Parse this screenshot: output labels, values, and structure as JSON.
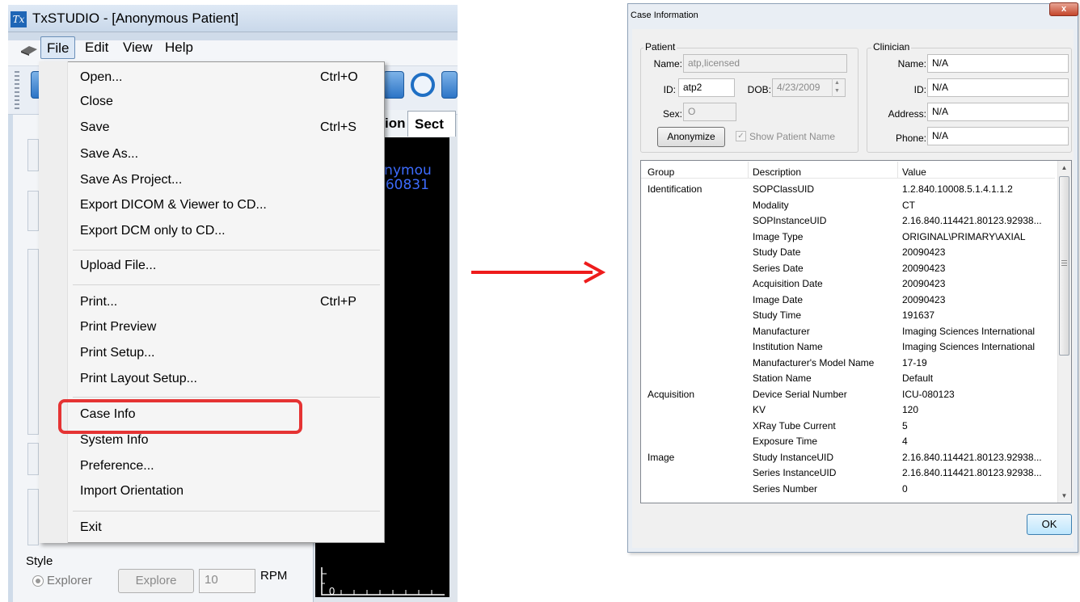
{
  "app": {
    "logo_text": "Tx",
    "title": "TxSTUDIO - [Anonymous Patient]",
    "menus": [
      "File",
      "Edit",
      "View",
      "Help"
    ],
    "tab_partial_1": "ion",
    "tab_partial_2": "Sect",
    "viewer_text_1": "nonymou",
    "viewer_text_2": "760831",
    "style_label": "Style",
    "explorer_label": "Explorer",
    "explore_button": "Explore",
    "rpm_value": "10",
    "rpm_label": "RPM",
    "ruler_label": "0"
  },
  "file_menu": {
    "items": [
      {
        "label": "Open...",
        "shortcut": "Ctrl+O"
      },
      {
        "label": "Close",
        "shortcut": ""
      },
      {
        "label": "Save",
        "shortcut": "Ctrl+S"
      },
      {
        "label": "Save As...",
        "shortcut": ""
      },
      {
        "label": "Save As Project...",
        "shortcut": ""
      },
      {
        "label": "Export DICOM & Viewer to CD...",
        "shortcut": ""
      },
      {
        "label": "Export DCM only to CD...",
        "shortcut": ""
      },
      {
        "label": "Upload File...",
        "shortcut": ""
      },
      {
        "label": "Print...",
        "shortcut": "Ctrl+P"
      },
      {
        "label": "Print Preview",
        "shortcut": ""
      },
      {
        "label": "Print Setup...",
        "shortcut": ""
      },
      {
        "label": "Print Layout Setup...",
        "shortcut": ""
      },
      {
        "label": "Case Info",
        "shortcut": ""
      },
      {
        "label": "System Info",
        "shortcut": ""
      },
      {
        "label": "Preference...",
        "shortcut": ""
      },
      {
        "label": "Import Orientation",
        "shortcut": ""
      },
      {
        "label": "Exit",
        "shortcut": ""
      }
    ],
    "highlighted_item": "Case Info",
    "highlight_color": "#e53333"
  },
  "arrow_color": "#ee1c1c",
  "dialog": {
    "title": "Case Information",
    "close_glyph": "x",
    "patient": {
      "group_label": "Patient",
      "name_label": "Name:",
      "name_value": "atp,licensed",
      "id_label": "ID:",
      "id_value": "atp2",
      "dob_label": "DOB:",
      "dob_value": "4/23/2009",
      "sex_label": "Sex:",
      "sex_value": "O",
      "anonymize_button": "Anonymize",
      "show_name_label": "Show Patient Name",
      "show_name_checked": true
    },
    "clinician": {
      "group_label": "Clinician",
      "name_label": "Name:",
      "name_value": "N/A",
      "id_label": "ID:",
      "id_value": "N/A",
      "address_label": "Address:",
      "address_value": "N/A",
      "phone_label": "Phone:",
      "phone_value": "N/A"
    },
    "table": {
      "columns": [
        "Group",
        "Description",
        "Value"
      ],
      "rows": [
        {
          "group": "Identification",
          "description": "SOPClassUID",
          "value": "1.2.840.10008.5.1.4.1.1.2"
        },
        {
          "group": "",
          "description": "Modality",
          "value": "CT"
        },
        {
          "group": "",
          "description": "SOPInstanceUID",
          "value": "2.16.840.114421.80123.92938..."
        },
        {
          "group": "",
          "description": "Image Type",
          "value": "ORIGINAL\\PRIMARY\\AXIAL"
        },
        {
          "group": "",
          "description": "Study Date",
          "value": "20090423"
        },
        {
          "group": "",
          "description": "Series Date",
          "value": "20090423"
        },
        {
          "group": "",
          "description": "Acquisition Date",
          "value": "20090423"
        },
        {
          "group": "",
          "description": "Image Date",
          "value": "20090423"
        },
        {
          "group": "",
          "description": "Study Time",
          "value": "191637"
        },
        {
          "group": "",
          "description": "Manufacturer",
          "value": "Imaging Sciences International"
        },
        {
          "group": "",
          "description": "Institution Name",
          "value": "Imaging Sciences International"
        },
        {
          "group": "",
          "description": "Manufacturer's Model Name",
          "value": "17-19"
        },
        {
          "group": "",
          "description": "Station Name",
          "value": "Default"
        },
        {
          "group": "Acquisition",
          "description": "Device Serial Number",
          "value": "ICU-080123"
        },
        {
          "group": "",
          "description": "KV",
          "value": "120"
        },
        {
          "group": "",
          "description": "XRay Tube Current",
          "value": "5"
        },
        {
          "group": "",
          "description": "Exposure Time",
          "value": "4"
        },
        {
          "group": "Image",
          "description": "Study InstanceUID",
          "value": "2.16.840.114421.80123.92938..."
        },
        {
          "group": "",
          "description": "Series InstanceUID",
          "value": "2.16.840.114421.80123.92938..."
        },
        {
          "group": "",
          "description": "Series Number",
          "value": "0"
        }
      ]
    },
    "ok_button": "OK"
  }
}
